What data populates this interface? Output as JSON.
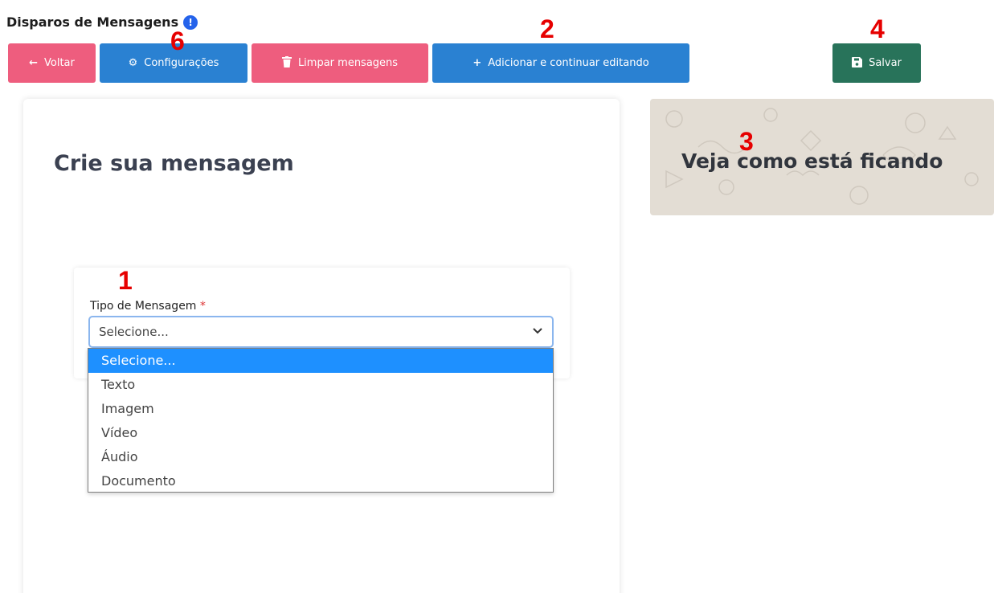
{
  "header": {
    "title": "Disparos de Mensagens",
    "info_icon": "info-circle-icon"
  },
  "toolbar": {
    "back_label": "Voltar",
    "settings_label": "Configurações",
    "clear_label": "Limpar mensagens",
    "add_continue_label": "Adicionar e continuar editando",
    "save_label": "Salvar"
  },
  "markers": {
    "m1": "1",
    "m2": "2",
    "m3": "3",
    "m4": "4",
    "m6": "6"
  },
  "left_panel": {
    "title": "Crie sua mensagem"
  },
  "preview_panel": {
    "title": "Veja como está ficando"
  },
  "form": {
    "type_label": "Tipo de Mensagem",
    "required_mark": "*",
    "select_value": "Selecione...",
    "options": [
      "Selecione...",
      "Texto",
      "Imagem",
      "Vídeo",
      "Áudio",
      "Documento"
    ],
    "selected_index": 0
  },
  "colors": {
    "pink_button": "#ee5d7e",
    "blue_button": "#2a81d2",
    "green_button": "#28735a",
    "highlight": "#1e90ff",
    "marker": "#e60000"
  },
  "icons": {
    "back": "arrow-left-icon",
    "settings": "gear-icon",
    "clear": "trash-icon",
    "add": "plus-icon",
    "save": "floppy-disk-icon",
    "select": "chevron-down-icon"
  }
}
